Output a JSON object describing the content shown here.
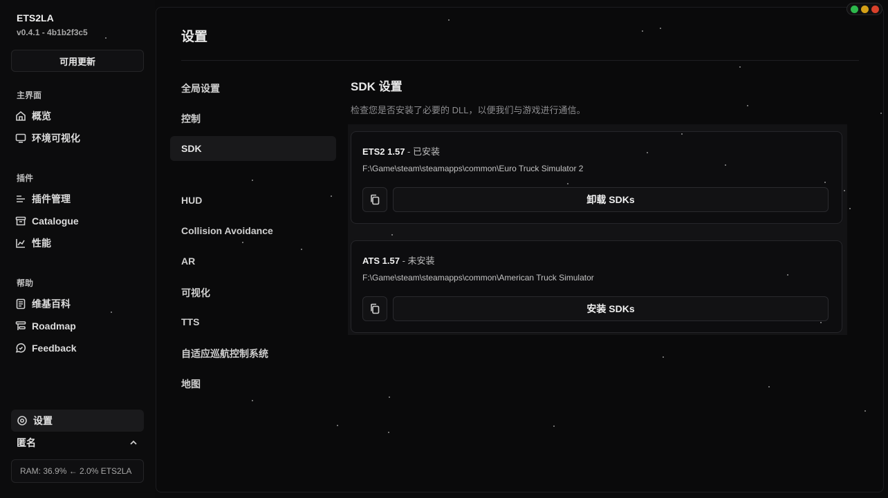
{
  "app": {
    "title": "ETS2LA",
    "version": "v0.4.1 - 4b1b2f3c5",
    "update_label": "可用更新"
  },
  "sidebar": {
    "sections": [
      {
        "label": "主界面",
        "items": [
          {
            "label": "概览",
            "icon": "home-icon"
          },
          {
            "label": "环境可视化",
            "icon": "monitor-icon"
          }
        ]
      },
      {
        "label": "插件",
        "items": [
          {
            "label": "插件管理",
            "icon": "list-icon"
          },
          {
            "label": "Catalogue",
            "icon": "archive-icon"
          },
          {
            "label": "性能",
            "icon": "chart-icon"
          }
        ]
      },
      {
        "label": "帮助",
        "items": [
          {
            "label": "维基百科",
            "icon": "book-icon"
          },
          {
            "label": "Roadmap",
            "icon": "roadmap-icon"
          },
          {
            "label": "Feedback",
            "icon": "feedback-icon"
          }
        ]
      }
    ],
    "settings_label": "设置",
    "user_label": "匿名",
    "stats": "RAM: 36.9% ← 2.0% ETS2LA"
  },
  "main": {
    "title": "设置",
    "subnav": [
      "全局设置",
      "控制",
      "SDK",
      "HUD",
      "Collision Avoidance",
      "AR",
      "可视化",
      "TTS",
      "自适应巡航控制系统",
      "地图"
    ],
    "sdk": {
      "title": "SDK 设置",
      "description": "检查您是否安装了必要的 DLL，以便我们与游戏进行通信。",
      "games": [
        {
          "name": "ETS2 1.57",
          "status": " - 已安装",
          "path": "F:\\Game\\steam\\steamapps\\common\\Euro Truck Simulator 2",
          "action": "卸载 SDKs"
        },
        {
          "name": "ATS 1.57",
          "status": " - 未安装",
          "path": "F:\\Game\\steam\\steamapps\\common\\American Truck Simulator",
          "action": "安装 SDKs"
        }
      ]
    }
  },
  "colors": {
    "close": "#2db84c",
    "minimize": "#d4a017",
    "maximize": "#d9412b"
  }
}
